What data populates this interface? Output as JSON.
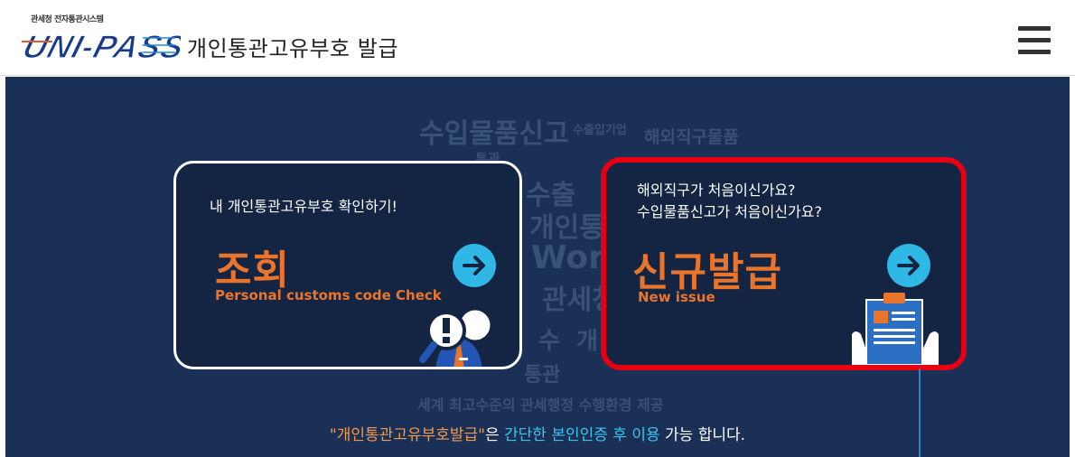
{
  "header": {
    "logo_subtitle": "관세청 전자통관시스템",
    "logo_text": "UNI-PASS",
    "title": "개인통관고유부호 발급",
    "menu_icon": "hamburger-menu-icon"
  },
  "background_words": [
    "수입물품신고",
    "수출입기업",
    "해외직구물품",
    "통관",
    "수출",
    "개인통관",
    "World",
    "관세청",
    "세계",
    "수",
    "개",
    "통관",
    "세계 최고수준의 관세행정 수행환경 제공"
  ],
  "cards": {
    "lookup": {
      "subtitle": "내 개인통관고유부호 확인하기!",
      "title": "조회",
      "english": "Personal customs code Check",
      "arrow_icon": "arrow-right-circle-icon",
      "illustration_icon": "magnifier-person-icon"
    },
    "new_issue": {
      "subtitle_line1": "해외직구가 처음이신가요?",
      "subtitle_line2": "수입물품신고가 처음이신가요?",
      "title": "신규발급",
      "english": "New issue",
      "arrow_icon": "arrow-right-circle-icon",
      "illustration_icon": "clipboard-document-icon"
    }
  },
  "notice": {
    "part1": "\"개인통관고유부호발급\"",
    "part2": "은 ",
    "part3": "간단한 본인인증 후 이용",
    "part4": " 가능 합니다."
  },
  "colors": {
    "hero_background": "#1a3056",
    "card_background": "#142544",
    "accent_orange": "#e8752b",
    "accent_cyan": "#2fb8e6",
    "highlight_border": "#e60012"
  }
}
